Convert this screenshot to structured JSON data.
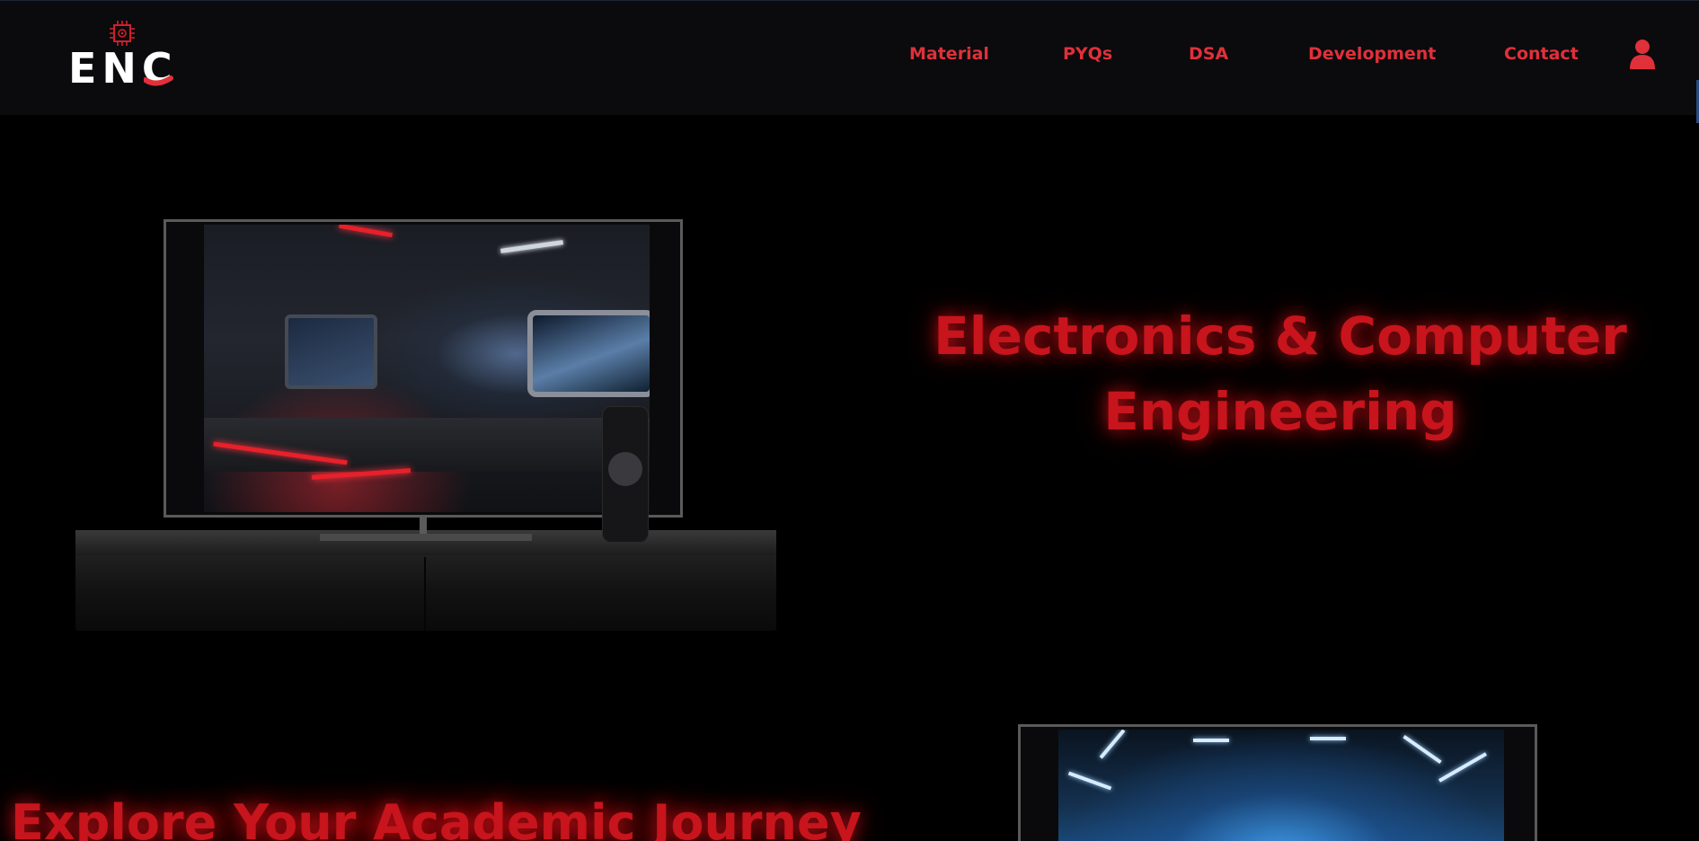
{
  "logo": {
    "text": "ENC",
    "icon": "chip-icon",
    "colors": {
      "text": "#ffffff",
      "accent": "#e0303a"
    }
  },
  "nav": {
    "items": [
      {
        "label": "Material"
      },
      {
        "label": "PYQs"
      },
      {
        "label": "DSA"
      },
      {
        "label": "Development"
      },
      {
        "label": "Contact"
      }
    ],
    "user_icon": "user-icon",
    "color": "#e0303a"
  },
  "hero": {
    "title_line1": "Electronics & Computer",
    "title_line2": "Engineering",
    "title_color": "#c8141c"
  },
  "section2": {
    "title": "Explore Your Academic Journey"
  }
}
